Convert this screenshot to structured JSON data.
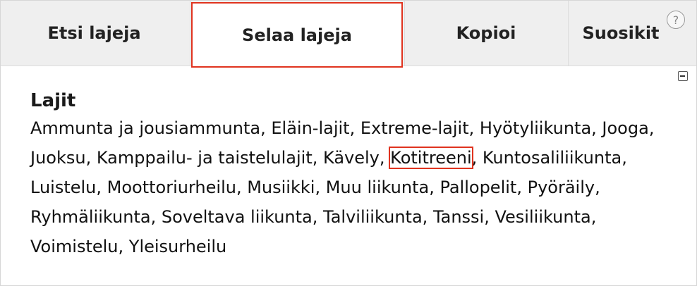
{
  "tabs": [
    {
      "label": "Etsi lajeja",
      "active": false
    },
    {
      "label": "Selaa lajeja",
      "active": true
    },
    {
      "label": "Kopioi",
      "active": false
    },
    {
      "label": "Suosikit",
      "active": false
    }
  ],
  "help_icon": {
    "glyph": "?",
    "icon": "help-icon"
  },
  "collapse_icon": {
    "icon": "collapse-icon"
  },
  "category": {
    "heading": "Lajit",
    "sports": [
      "Ammunta ja jousiammunta",
      "Eläin-lajit",
      "Extreme-lajit",
      "Hyötyliikunta",
      "Jooga",
      "Juoksu",
      "Kamppailu- ja taistelulajit",
      "Kävely",
      "Kotitreeni",
      "Kuntosaliliikunta",
      "Luistelu",
      "Moottoriurheilu",
      "Musiikki",
      "Muu liikunta",
      "Pallopelit",
      "Pyöräily",
      "Ryhmäliikunta",
      "Soveltava liikunta",
      "Talviliikunta",
      "Tanssi",
      "Vesiliikunta",
      "Voimistelu",
      "Yleisurheilu"
    ],
    "highlighted": "Kotitreeni"
  },
  "colors": {
    "accent_outline": "#e0331f",
    "tabbar_bg": "#efefef"
  }
}
